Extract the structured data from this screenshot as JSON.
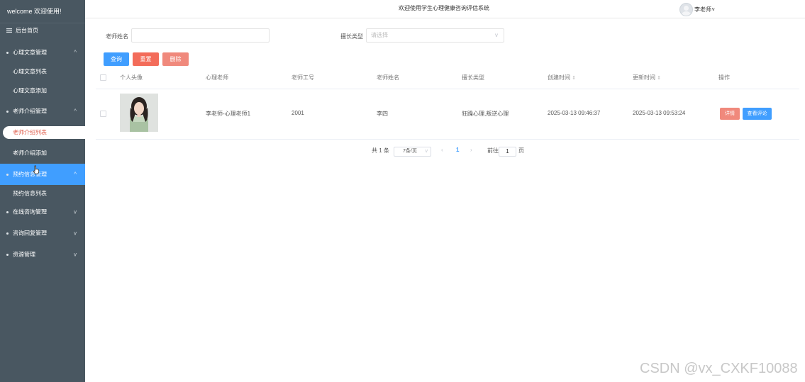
{
  "sidebar": {
    "brand": "welcome 欢迎使用!",
    "home": "后台首页",
    "groups": [
      {
        "label": "心理文章管理",
        "chev": "^",
        "subs": [
          "心理文章列表",
          "心理文章添加"
        ]
      },
      {
        "label": "老师介绍管理",
        "chev": "^",
        "subs": [
          "老师介绍列表",
          "老师介绍添加"
        ]
      },
      {
        "label": "预约信息管理",
        "chev": "^",
        "subs": [
          "预约信息列表"
        ]
      },
      {
        "label": "在线咨询管理",
        "chev": "v",
        "subs": []
      },
      {
        "label": "咨询回复管理",
        "chev": "v",
        "subs": []
      },
      {
        "label": "资源管理",
        "chev": "v",
        "subs": []
      }
    ]
  },
  "header": {
    "title": "欢迎使用学生心理健康咨询评估系统",
    "user": "李老师",
    "user_caret": "v"
  },
  "search": {
    "name_label": "老师姓名",
    "name_value": "",
    "type_label": "擅长类型",
    "type_placeholder": "请选择",
    "type_arrow": "v"
  },
  "actions": {
    "query": "查询",
    "reset": "重置",
    "delete": "删除"
  },
  "table": {
    "headers": [
      "个人头像",
      "心理老师",
      "老师工号",
      "老师姓名",
      "擅长类型",
      "创建时间",
      "更新时间",
      "操作"
    ],
    "sort_glyph": "⇕",
    "rows": [
      {
        "teacher": "李老师-心理老师1",
        "id": "2001",
        "name": "李四",
        "type": "狂躁心理,叛逆心理",
        "created": "2025-03-13 09:46:37",
        "updated": "2025-03-13 09:53:24",
        "detail": "详情",
        "reviews": "查看评论"
      }
    ]
  },
  "pagination": {
    "total": "共 1 条",
    "page_size": "7条/页",
    "prev": "‹",
    "current": "1",
    "next": "›",
    "goto": "前往",
    "goto_value": "1",
    "page_unit": "页"
  },
  "watermark": "CSDN @vx_CXKF10088",
  "colors": {
    "sidebar_bg": "#495761",
    "active_menu": "#409eff",
    "active_sub_text": "#e0604f",
    "primary": "#409eff",
    "danger": "#f36c5a"
  }
}
